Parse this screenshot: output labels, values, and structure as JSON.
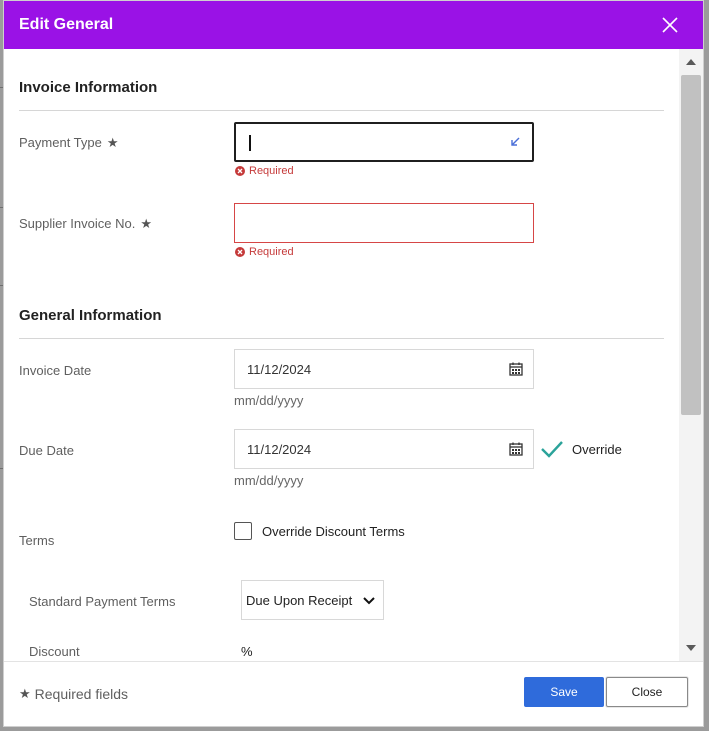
{
  "dialog": {
    "title": "Edit General",
    "colors": {
      "header": "#9a12e6",
      "save": "#2f6bdb",
      "error": "#d64646",
      "check": "#2ba39a"
    }
  },
  "invoice_info": {
    "heading": "Invoice Information",
    "payment_type": {
      "label": "Payment Type",
      "value": "",
      "error": "Required"
    },
    "supplier_invoice": {
      "label": "Supplier Invoice No.",
      "value": "",
      "error": "Required"
    }
  },
  "general_info": {
    "heading": "General Information",
    "invoice_date": {
      "label": "Invoice Date",
      "value": "11/12/2024",
      "hint": "mm/dd/yyyy"
    },
    "due_date": {
      "label": "Due Date",
      "value": "11/12/2024",
      "hint": "mm/dd/yyyy",
      "override_label": "Override"
    },
    "terms": {
      "label": "Terms",
      "override_discount_label": "Override Discount Terms",
      "checked": false
    },
    "standard_payment_terms": {
      "label": "Standard Payment Terms",
      "selected": "Due Upon Receipt"
    },
    "discount": {
      "label": "Discount",
      "unit": "%"
    }
  },
  "footer": {
    "required_note": "Required fields",
    "save_label": "Save",
    "close_label": "Close"
  },
  "icons": [
    "close-icon",
    "star-icon",
    "corner-arrow-icon",
    "error-icon",
    "calendar-icon",
    "checkmark-icon",
    "chevron-down-icon",
    "scroll-up-icon",
    "scroll-down-icon"
  ]
}
